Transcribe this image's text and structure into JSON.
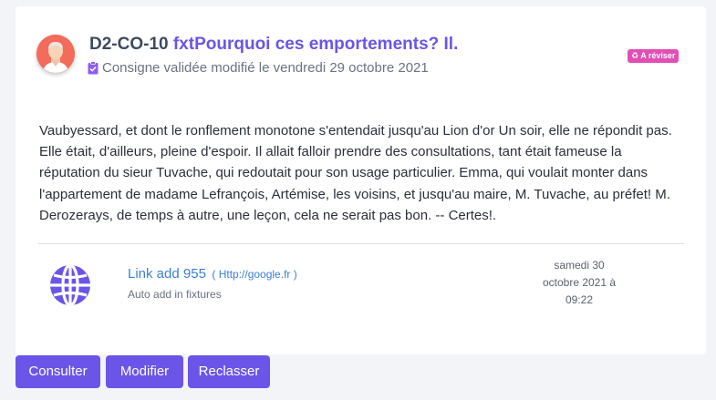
{
  "header": {
    "code": "D2-CO-10",
    "title": "fxtPourquoi ces emportements? Il.",
    "subtitle": "Consigne validée modifié le vendredi 29 octobre 2021",
    "badge": "♻ A réviser"
  },
  "body": {
    "text": "Vaubyessard, et dont le ronflement monotone s'entendait jusqu'au Lion d'or Un soir, elle ne répondit pas. Elle était, d'ailleurs, pleine d'espoir. Il allait falloir prendre des consultations, tant était fameuse la réputation du sieur Tuvache, qui redoutait pour son usage particulier. Emma, qui voulait monter dans l'appartement de madame Lefrançois, Artémise, les voisins, et jusqu'au maire, M. Tuvache, au préfet! M. Derozerays, de temps à autre, une leçon, cela ne serait pas bon. -- Certes!."
  },
  "link": {
    "title": "Link add 955",
    "url": "( Http://google.fr )",
    "subtitle": "Auto add in fixtures",
    "date": "samedi 30 octobre 2021 à 09:22",
    "icon": "globe-icon"
  },
  "actions": {
    "consult": "Consulter",
    "edit": "Modifier",
    "reclass": "Reclasser"
  },
  "colors": {
    "accent": "#6a55e8",
    "badge": "#e14fb5",
    "link": "#3a7fd5",
    "avatar_bg": "#f26b5b"
  }
}
